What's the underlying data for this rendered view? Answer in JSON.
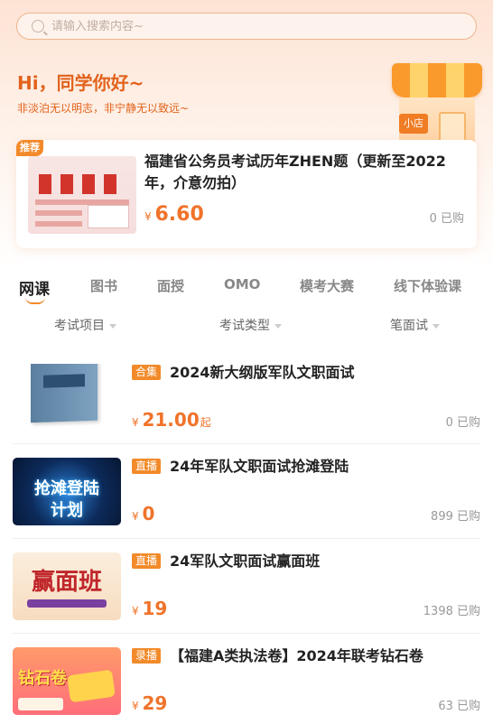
{
  "search": {
    "placeholder": "请输入搜索内容~"
  },
  "greeting": {
    "title": "Hi，同学你好~",
    "subtitle": "非淡泊无以明志，非宁静无以致远~"
  },
  "shop": {
    "sign": "小店"
  },
  "recommend": {
    "badge": "推荐",
    "title": "福建省公务员考试历年ZHEN题（更新至2022年，介意勿拍）",
    "currency": "¥",
    "price": "6.60",
    "sold": "0 已购"
  },
  "tabs": [
    {
      "label": "网课",
      "active": true
    },
    {
      "label": "图书"
    },
    {
      "label": "面授"
    },
    {
      "label": "OMO"
    },
    {
      "label": "模考大赛"
    },
    {
      "label": "线下体验课"
    }
  ],
  "filters": [
    {
      "label": "考试项目"
    },
    {
      "label": "考试类型"
    },
    {
      "label": "笔面试"
    }
  ],
  "courses": [
    {
      "tag": "合集",
      "title": "2024新大纲版军队文职面试",
      "currency": "¥",
      "price": "21.00",
      "suffix": "起",
      "sold": "0 已购"
    },
    {
      "tag": "直播",
      "title": "24年军队文职面试抢滩登陆",
      "currency": "¥",
      "price": "0",
      "sold": "899 已购",
      "thumb_line1": "抢滩登陆",
      "thumb_line2": "计划"
    },
    {
      "tag": "直播",
      "title": "24军队文职面试赢面班",
      "currency": "¥",
      "price": "19",
      "sold": "1398 已购",
      "thumb_text": "赢面班"
    },
    {
      "tag": "录播",
      "title": "【福建A类执法卷】2024年联考钻石卷",
      "currency": "¥",
      "price": "29",
      "sold": "63 已购",
      "thumb_text": "钻石卷"
    }
  ],
  "colors": {
    "accent": "#f0732a",
    "badge": "#f28a2a"
  }
}
